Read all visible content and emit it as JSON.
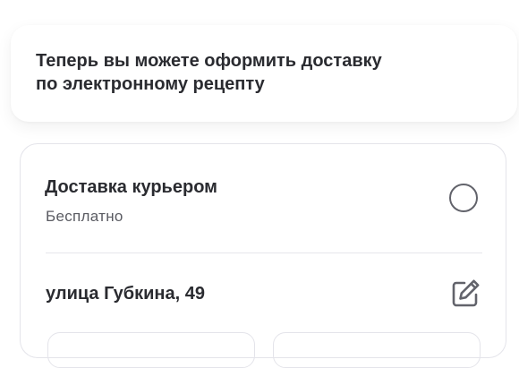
{
  "notice": {
    "line1": "Теперь вы можете оформить доставку",
    "line2": "по электронному рецепту"
  },
  "delivery_option": {
    "title": "Доставка курьером",
    "price": "Бесплатно",
    "selected": false
  },
  "address": {
    "value": "улица Губкина, 49",
    "edit_icon": "edit-icon"
  },
  "colors": {
    "text_primary": "#2a2b30",
    "text_secondary": "#5a5b62",
    "border": "#e4e4ea",
    "icon": "#62636b"
  }
}
